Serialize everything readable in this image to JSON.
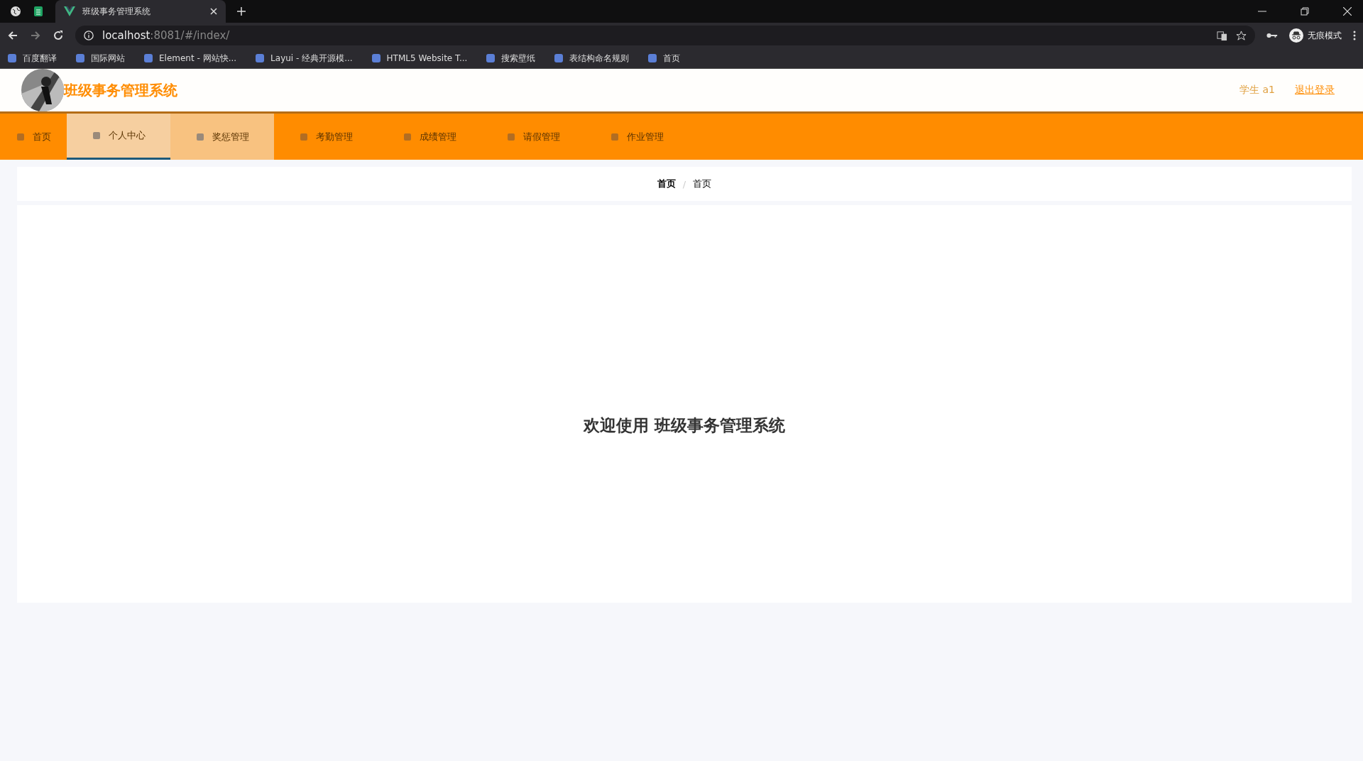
{
  "browser": {
    "tab_title": "班级事务管理系统",
    "url_host": "localhost",
    "url_path": ":8081/#/index/",
    "profile": "无痕模式",
    "bookmarks": [
      "百度翻译",
      "国际网站",
      "Element - 网站快...",
      "Layui - 经典开源模...",
      "HTML5 Website T...",
      "搜索壁纸",
      "表结构命名规则",
      "首页"
    ]
  },
  "header": {
    "title": "班级事务管理系统",
    "user": "学生 a1",
    "logout": "退出登录"
  },
  "nav": [
    {
      "label": "首页",
      "selected": false,
      "hovered": false
    },
    {
      "label": "个人中心",
      "selected": true,
      "hovered": false
    },
    {
      "label": "奖惩管理",
      "selected": false,
      "hovered": true
    },
    {
      "label": "考勤管理",
      "selected": false,
      "hovered": false
    },
    {
      "label": "成绩管理",
      "selected": false,
      "hovered": false
    },
    {
      "label": "请假管理",
      "selected": false,
      "hovered": false
    },
    {
      "label": "作业管理",
      "selected": false,
      "hovered": false
    }
  ],
  "breadcrumb": {
    "items": [
      "首页",
      "首页"
    ],
    "separator": "/"
  },
  "welcome": "欢迎使用 班级事务管理系统"
}
